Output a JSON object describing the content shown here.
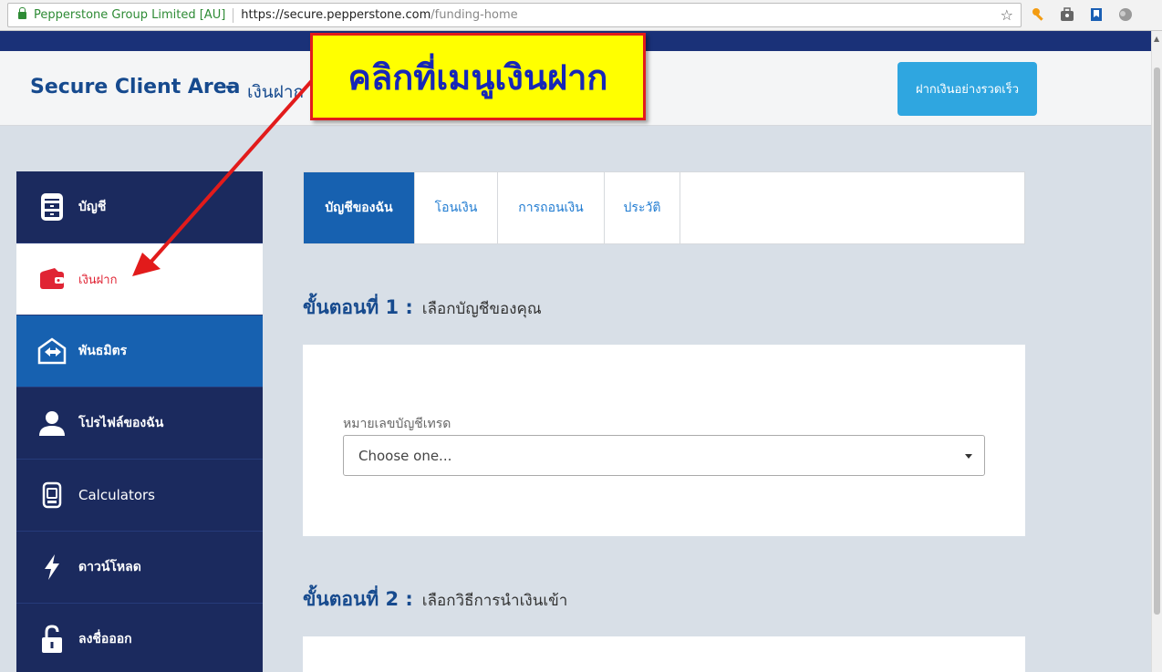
{
  "browser": {
    "site_identity": "Pepperstone Group Limited [AU]",
    "url_host": "https://secure.pepperstone.com",
    "url_path": "/funding-home"
  },
  "header": {
    "brand": "Secure Client Area",
    "dash": "-",
    "page_name": "เงินฝาก",
    "quick_deposit_label": "ฝากเงินอย่างรวดเร็ว"
  },
  "sidebar": {
    "items": [
      {
        "label": "บัญชี",
        "icon": "account-icon"
      },
      {
        "label": "เงินฝาก",
        "icon": "wallet-icon",
        "active": true
      },
      {
        "label": "พันธมิตร",
        "icon": "partner-icon"
      },
      {
        "label": "โปรไฟล์ของฉัน",
        "icon": "user-icon"
      },
      {
        "label": "Calculators",
        "icon": "calculator-icon"
      },
      {
        "label": "ดาวน์โหลด",
        "icon": "lightning-icon"
      },
      {
        "label": "ลงชื่อออก",
        "icon": "unlock-icon"
      }
    ]
  },
  "tabs": [
    {
      "label": "บัญชีของฉัน",
      "active": true
    },
    {
      "label": "โอนเงิน"
    },
    {
      "label": "การถอนเงิน"
    },
    {
      "label": "ประวัติ"
    }
  ],
  "steps": [
    {
      "number": "ขั้นตอนที่ 1 :",
      "text": "เลือกบัญชีของคุณ"
    },
    {
      "number": "ขั้นตอนที่ 2 :",
      "text": "เลือกวิธีการนำเงินเข้า"
    }
  ],
  "account_select": {
    "label": "หมายเลขบัญชีเทรด",
    "value": "Choose one..."
  },
  "callout": {
    "text": "คลิกที่เมนูเงินฝาก"
  },
  "colors": {
    "navy": "#1b2a5e",
    "blue_active": "#1761b0",
    "accent_red": "#e02434",
    "quick_button": "#2fa6e0",
    "callout_bg": "#ffff00"
  }
}
